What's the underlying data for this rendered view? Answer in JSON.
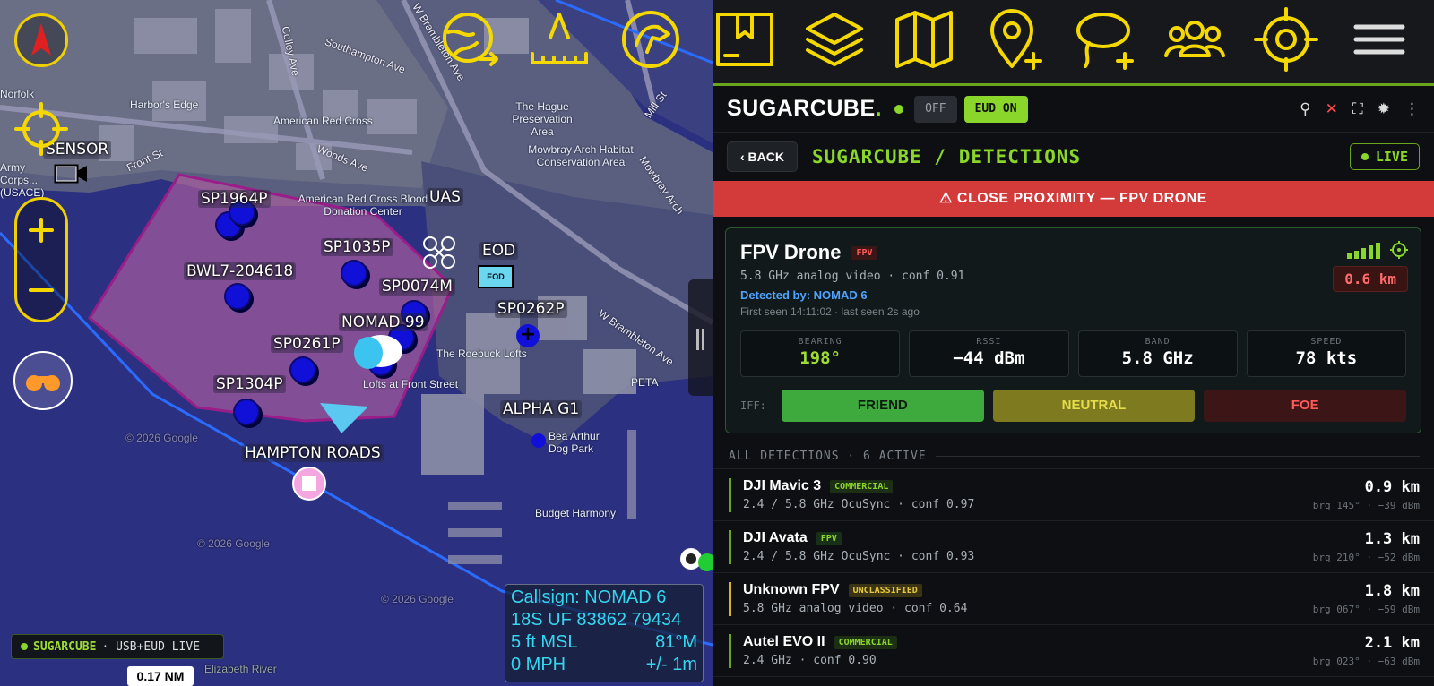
{
  "map": {
    "labels": {
      "sensor": "SENSOR",
      "uas": "UAS",
      "eod": "EOD",
      "eod_icon_text": "EOD",
      "nomad": "NOMAD 99",
      "hampton": "HAMPTON ROADS",
      "alpha": "ALPHA G1",
      "sp1964": "SP1964P",
      "bwl7": "BWL7-204618",
      "sp1035": "SP1035P",
      "sp0074": "SP0074M",
      "sp0262": "SP0262P",
      "sp0261": "SP0261P",
      "sp1304": "SP1304P"
    },
    "streets": {
      "colley": "Colley Ave",
      "southampton": "Southampton Ave",
      "woods": "Woods Ave",
      "front": "Front St",
      "wbrambleton": "W Brambleton Ave",
      "wbrambleton2": "W Brambleton Ave",
      "mill": "Mill St",
      "mowbray": "Mowbray Arch"
    },
    "pois": {
      "norfolk": "Norfolk",
      "harbors": "Harbor's Edge",
      "redcross": "American Red Cross",
      "redcross2": "American Red Cross Blood Donation Center",
      "hague": "The Hague Preservation Area",
      "mowbrayhab": "Mowbray Arch Habitat Conservation Area",
      "roebuck": "The Roebuck Lofts",
      "lofts": "Lofts at Front Street",
      "peta": "PETA",
      "beaarthur": "Bea Arthur Dog Park",
      "budget": "Budget Harmony",
      "corps": "Army Corps...(USACE)",
      "river": "Elizabeth River",
      "google1": "© 2026 Google",
      "google2": "© 2026 Google",
      "google3": "© 2026 Google"
    },
    "callsign": {
      "l1": "Callsign: NOMAD 6",
      "l2a": "18S  UF  83862  79434",
      "l3a": "5 ft MSL",
      "l3b": "81°M",
      "l4a": "0 MPH",
      "l4b": "+/- 1m"
    },
    "status": {
      "name": "SUGARCUBE",
      "rest": "· USB+EUD LIVE"
    },
    "scale": "0.17 NM"
  },
  "panel": {
    "brand": "SUGARCUBE",
    "brand_dot": ".",
    "off": "OFF",
    "eud_on": "EUD ON",
    "back": "‹ BACK",
    "crumb": "SUGARCUBE / DETECTIONS",
    "live": "LIVE",
    "alert": "⚠ CLOSE PROXIMITY — FPV DRONE",
    "card": {
      "name": "FPV Drone",
      "tag": "FPV",
      "sub": "5.8 GHz analog video · conf 0.91",
      "detected": "Detected by: NOMAD 6",
      "seen": "First seen 14:11:02 · last seen 2s ago",
      "distance": "0.6 km",
      "metrics": [
        {
          "k": "BEARING",
          "v": "198°"
        },
        {
          "k": "RSSI",
          "v": "−44 dBm"
        },
        {
          "k": "BAND",
          "v": "5.8 GHz"
        },
        {
          "k": "SPEED",
          "v": "78 kts"
        }
      ],
      "iff_label": "IFF:",
      "iff": {
        "friend": "FRIEND",
        "neutral": "NEUTRAL",
        "foe": "FOE"
      }
    },
    "list_header": "ALL DETECTIONS · 6 ACTIVE",
    "rows": [
      {
        "name": "DJI Mavic 3",
        "tag": "COMMERCIAL",
        "sub": "2.4 / 5.8 GHz OcuSync · conf 0.97",
        "dist": "0.9 km",
        "brg": "brg 145° · −39 dBm"
      },
      {
        "name": "DJI Avata",
        "tag": "FPV",
        "sub": "2.4 / 5.8 GHz OcuSync · conf 0.93",
        "dist": "1.3 km",
        "brg": "brg 210° · −52 dBm"
      },
      {
        "name": "Unknown FPV",
        "tag": "UNCLASSIFIED",
        "sub": "5.8 GHz analog video · conf 0.64",
        "dist": "1.8 km",
        "brg": "brg 067° · −59 dBm"
      },
      {
        "name": "Autel EVO II",
        "tag": "COMMERCIAL",
        "sub": "2.4 GHz · conf 0.90",
        "dist": "2.1 km",
        "brg": "brg 023° · −63 dBm"
      }
    ]
  }
}
